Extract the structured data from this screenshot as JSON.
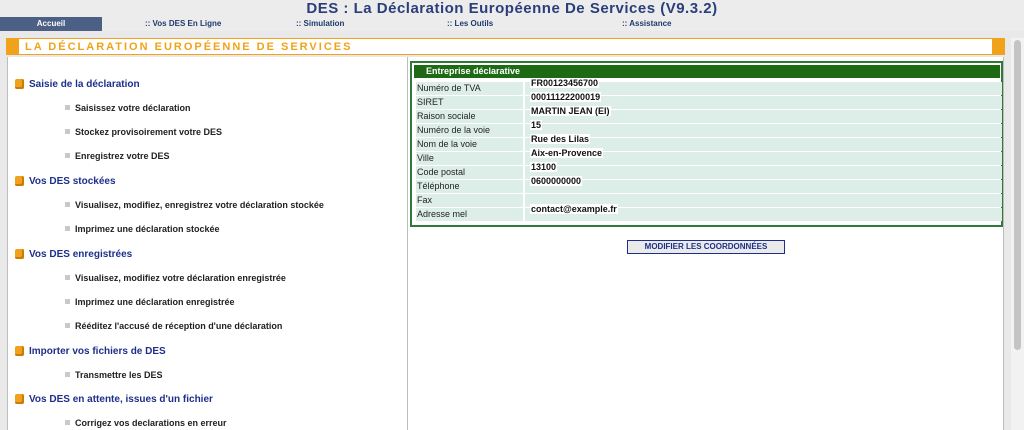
{
  "app": {
    "title": "DES : La Déclaration Européenne De Services (V9.3.2)"
  },
  "nav": {
    "tabs": [
      {
        "label": "Accueil"
      },
      {
        "label": ":: Vos DES En Ligne"
      },
      {
        "label": ":: Simulation"
      },
      {
        "label": ":: Les Outils"
      },
      {
        "label": ":: Assistance"
      }
    ]
  },
  "section": {
    "title": "LA DÉCLARATION EUROPÉENNE DE SERVICES"
  },
  "menu": {
    "groups": [
      {
        "heading": "Saisie de la déclaration",
        "items": [
          "Saisissez votre déclaration",
          "Stockez provisoirement votre DES",
          "Enregistrez votre DES"
        ]
      },
      {
        "heading": "Vos DES stockées",
        "items": [
          "Visualisez, modifiez, enregistrez votre déclaration stockée",
          "Imprimez une déclaration stockée"
        ]
      },
      {
        "heading": "Vos DES enregistrées",
        "items": [
          "Visualisez, modifiez votre déclaration enregistrée",
          "Imprimez une déclaration enregistrée",
          "Rééditez l'accusé de réception d'une déclaration"
        ]
      },
      {
        "heading": "Importer vos fichiers de DES",
        "items": [
          "Transmettre les DES"
        ]
      },
      {
        "heading": "Vos DES en attente, issues d'un fichier",
        "items": [
          "Corrigez vos declarations en erreur"
        ]
      }
    ]
  },
  "company": {
    "header": "Entreprise déclarative",
    "rows": [
      {
        "label": "Numéro de TVA",
        "value": "FR00123456700"
      },
      {
        "label": "SIRET",
        "value": "00011122200019"
      },
      {
        "label": "Raison sociale",
        "value": "MARTIN JEAN (EI)"
      },
      {
        "label": "Numéro de la voie",
        "value": "15"
      },
      {
        "label": "Nom de la voie",
        "value": "Rue des Lilas"
      },
      {
        "label": "Ville",
        "value": "Aix-en-Provence"
      },
      {
        "label": "Code postal",
        "value": "13100"
      },
      {
        "label": "Téléphone",
        "value": "0600000000"
      },
      {
        "label": "Fax",
        "value": ""
      },
      {
        "label": "Adresse mel",
        "value": "contact@example.fr"
      }
    ]
  },
  "actions": {
    "modify_label": "MODIFIER LES COORDONNÉES"
  }
}
